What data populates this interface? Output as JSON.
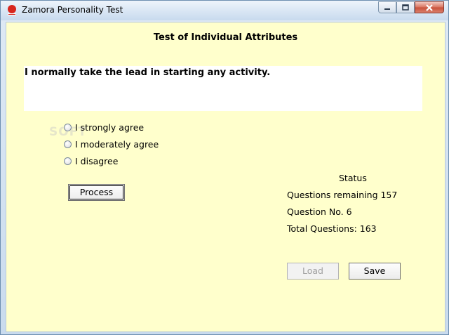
{
  "window": {
    "title": "Zamora Personality Test",
    "minimize_icon": "minimize-icon",
    "maximize_icon": "maximize-icon",
    "close_icon": "close-icon",
    "app_icon": "zamora-app-icon",
    "app_icon_colors": {
      "red": "#d8261e",
      "white": "#ffffff"
    }
  },
  "main": {
    "heading": "Test of Individual Attributes",
    "question": "I normally take the lead in starting any activity.",
    "options": [
      {
        "label": "I strongly agree",
        "selected": false
      },
      {
        "label": "I moderately agree",
        "selected": false
      },
      {
        "label": "I disagree",
        "selected": false
      }
    ],
    "process_button": "Process",
    "watermark": "SOFT"
  },
  "status": {
    "title": "Status",
    "remaining": "Questions remaining 157",
    "question_no": "Question No. 6",
    "total": "Total Questions: 163"
  },
  "buttons": {
    "load": "Load",
    "save": "Save",
    "load_enabled": false
  },
  "colors": {
    "client_background": "#ffffcc",
    "question_background": "#ffffff",
    "close_button": "#c9503a"
  }
}
